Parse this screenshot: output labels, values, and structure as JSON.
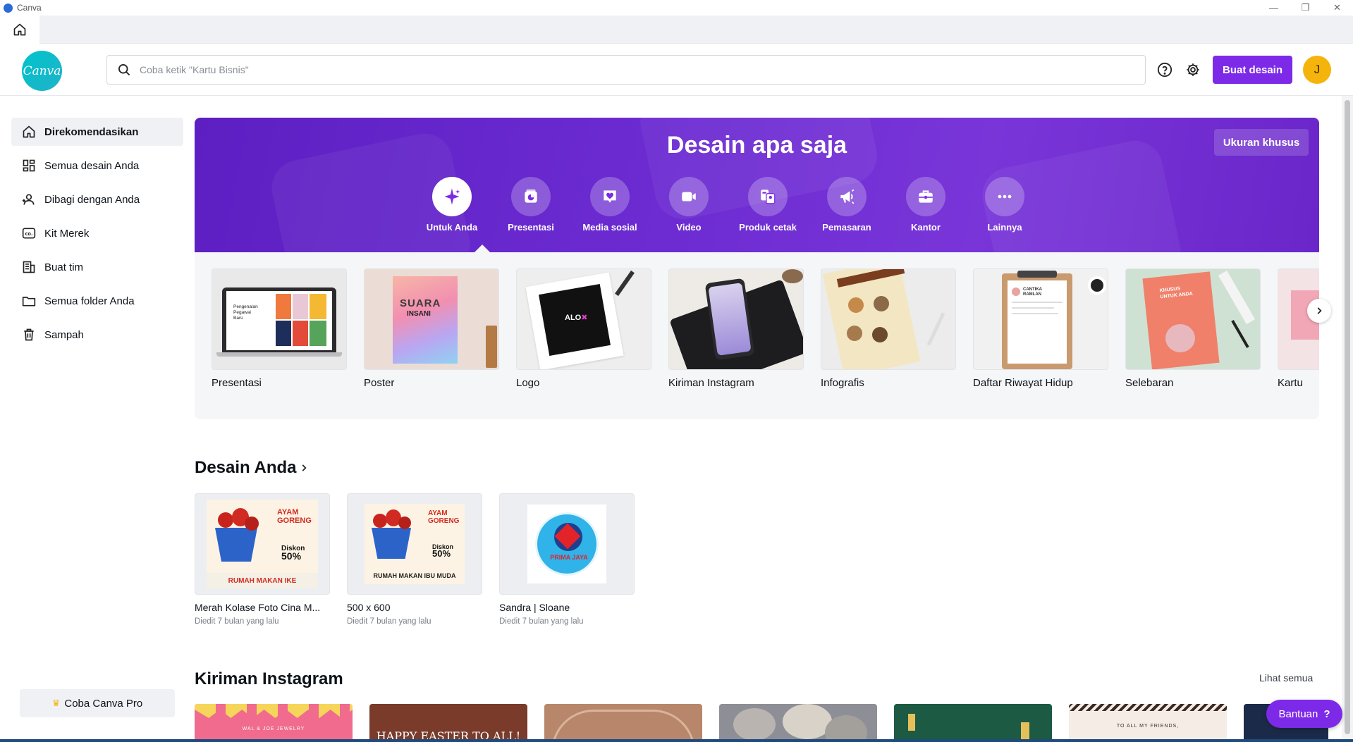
{
  "window": {
    "title": "Canva",
    "min": "—",
    "restore": "❐",
    "close": "✕"
  },
  "header": {
    "logo_text": "Canva",
    "search_placeholder": "Coba ketik \"Kartu Bisnis\"",
    "create_label": "Buat desain",
    "avatar_initial": "J"
  },
  "sidebar": {
    "items": [
      {
        "label": "Direkomendasikan",
        "icon": "home-icon"
      },
      {
        "label": "Semua desain Anda",
        "icon": "grid-icon"
      },
      {
        "label": "Dibagi dengan Anda",
        "icon": "users-icon"
      },
      {
        "label": "Kit Merek",
        "icon": "brand-kit-icon"
      },
      {
        "label": "Buat tim",
        "icon": "team-icon"
      },
      {
        "label": "Semua folder Anda",
        "icon": "folder-icon"
      },
      {
        "label": "Sampah",
        "icon": "trash-icon"
      }
    ],
    "pro_label": "Coba Canva Pro"
  },
  "hero": {
    "title": "Desain apa saja",
    "custom_size_label": "Ukuran khusus",
    "categories": [
      {
        "label": "Untuk Anda",
        "icon": "sparkle-icon"
      },
      {
        "label": "Presentasi",
        "icon": "presentation-icon"
      },
      {
        "label": "Media sosial",
        "icon": "heart-icon"
      },
      {
        "label": "Video",
        "icon": "video-icon"
      },
      {
        "label": "Produk cetak",
        "icon": "print-product-icon"
      },
      {
        "label": "Pemasaran",
        "icon": "megaphone-icon"
      },
      {
        "label": "Kantor",
        "icon": "briefcase-icon"
      },
      {
        "label": "Lainnya",
        "icon": "more-icon"
      }
    ]
  },
  "templates": {
    "items": [
      {
        "label": "Presentasi",
        "thumb_text_1": "Pengenalan",
        "thumb_text_2": "Pegawai",
        "thumb_text_3": "Baru"
      },
      {
        "label": "Poster",
        "thumb_text_1": "SUARA",
        "thumb_text_2": "INSANI"
      },
      {
        "label": "Logo",
        "thumb_text_1": "ALO"
      },
      {
        "label": "Kiriman Instagram"
      },
      {
        "label": "Infografis"
      },
      {
        "label": "Daftar Riwayat Hidup",
        "thumb_text_1": "CANTIKA",
        "thumb_text_2": "RAMLAN"
      },
      {
        "label": "Selebaran",
        "thumb_text_1": "KHUSUS",
        "thumb_text_2": "UNTUK ANDA"
      },
      {
        "label": "Kartu"
      }
    ]
  },
  "your_designs": {
    "title": "Desain Anda",
    "items": [
      {
        "name": "Merah Kolase Foto Cina M...",
        "meta": "Diedit 7 bulan yang lalu",
        "line1": "AYAM",
        "line2": "GORENG",
        "line3": "Diskon",
        "line4": "50%",
        "footer": "RUMAH MAKAN IKE"
      },
      {
        "name": "500 x 600",
        "meta": "Diedit 7 bulan yang lalu",
        "line1": "AYAM",
        "line2": "GORENG",
        "line3": "Diskon",
        "line4": "50%",
        "footer": "RUMAH MAKAN IBU MUDA"
      },
      {
        "name": "Sandra | Sloane",
        "meta": "Diedit 7 bulan yang lalu",
        "line1": "PRIMA JAYA"
      }
    ]
  },
  "instagram": {
    "title": "Kiriman Instagram",
    "see_all": "Lihat semua",
    "cards": [
      {
        "text": "WAL & JOE JEWELRY",
        "color": "#f06b8e"
      },
      {
        "text": "HAPPY EASTER TO ALL!",
        "color": "#7a3b2a"
      },
      {
        "text": "",
        "color": "#b8866a"
      },
      {
        "text": "",
        "color": "#8e8f96"
      },
      {
        "text": "",
        "color": "#1d5a43"
      },
      {
        "text": "TO ALL MY FRIENDS,",
        "color": "#f6ece6"
      },
      {
        "text": "",
        "color": "#1c2a4a"
      }
    ]
  },
  "help": {
    "label": "Bantuan",
    "icon": "?"
  },
  "colors": {
    "accent": "#7d2ae8",
    "logo": "#00c4cc",
    "avatar": "#f5b40b"
  }
}
